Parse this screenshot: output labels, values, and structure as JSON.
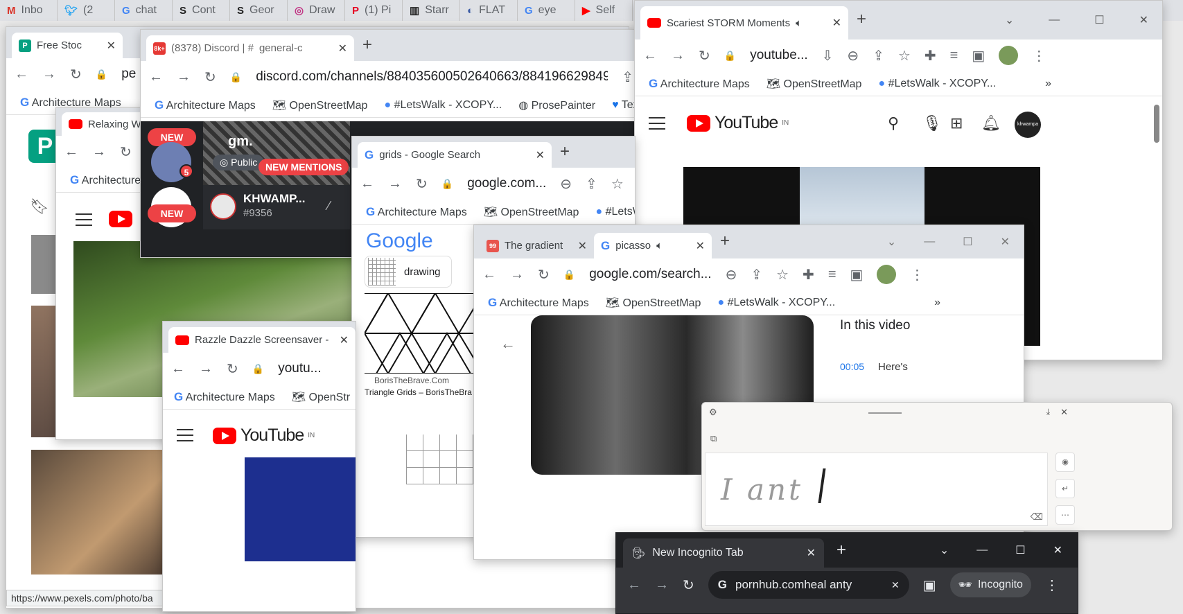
{
  "taskbar_tabs": [
    {
      "icon": "gmail-icon",
      "label": "Inbo"
    },
    {
      "icon": "twitter-icon",
      "label": "(2"
    },
    {
      "icon": "google-icon",
      "label": "chat"
    },
    {
      "icon": "s-icon",
      "label": "Cont"
    },
    {
      "icon": "s-icon",
      "label": "Geor"
    },
    {
      "icon": "instagram-icon",
      "label": "Draw"
    },
    {
      "icon": "pinterest-icon",
      "label": "(1) Pi"
    },
    {
      "icon": "starry-icon",
      "label": "Starr"
    },
    {
      "icon": "flat-icon",
      "label": "FLAT"
    },
    {
      "icon": "google-icon",
      "label": "eye"
    },
    {
      "icon": "youtube-icon",
      "label": "Self"
    }
  ],
  "pexels": {
    "tab1": "Free Stoc",
    "url_partial": "pe",
    "bookmark": "Architecture Maps",
    "status_url": "https://www.pexels.com/photo/ba"
  },
  "relaxing": {
    "tab": "Relaxing W",
    "bookmark": "Architecture"
  },
  "discord": {
    "tab": "(8378) Discord | #",
    "tab_channel": "general-c",
    "badge": "8k+",
    "url": "discord.com/channels/884035600502640663/884196629849...",
    "bookmarks": [
      "Architecture Maps",
      "OpenStreetMap",
      "#LetsWalk - XCOPY...",
      "ProsePainter",
      "Text"
    ],
    "new_label": "NEW",
    "server_badge": "5",
    "channel_title": "gm.",
    "public_label": "Public",
    "mentions": "NEW MENTIONS",
    "user_name": "KHWAMP...",
    "user_tag": "#9356"
  },
  "storm": {
    "tab": "Scariest STORM Moments",
    "url": "youtube...",
    "bookmarks": [
      "Architecture Maps",
      "OpenStreetMap",
      "#LetsWalk - XCOPY..."
    ],
    "logo": "YouTube",
    "region": "IN",
    "avatar": "khwampa"
  },
  "grids": {
    "tab": "grids - Google Search",
    "url": "google.com...",
    "bookmarks": [
      "Architecture Maps",
      "OpenStreetMap",
      "#LetsW"
    ],
    "logo": "Google",
    "chip": "drawing",
    "source": "BorisTheBrave.Com",
    "result_title": "Triangle Grids – BorisTheBra"
  },
  "picasso": {
    "tab1": "The gradient",
    "tab2": "picasso",
    "url": "google.com/search...",
    "bookmarks": [
      "Architecture Maps",
      "OpenStreetMap",
      "#LetsWalk - XCOPY..."
    ],
    "side_title": "In this video",
    "timestamp": "00:05",
    "timestamp_text": "Here's"
  },
  "razzle": {
    "tab": "Razzle Dazzle Screensaver -",
    "url": "youtu...",
    "bookmarks": [
      "Architecture Maps",
      "OpenStr"
    ],
    "logo": "YouTube",
    "region": "IN"
  },
  "handwriting": {
    "text": "I ant"
  },
  "incognito": {
    "tab": "New Incognito Tab",
    "url": "pornhub.comheal anty",
    "profile": "Incognito"
  }
}
